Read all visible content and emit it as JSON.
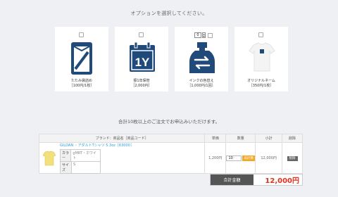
{
  "heading": "オプションを選択してください。",
  "options": [
    {
      "name": "たたみ袋詰め",
      "price": "［100円/1枚］",
      "icon": "folded-bag-icon"
    },
    {
      "name": "振1年保管",
      "price": "［2,000円］",
      "icon": "calendar-1y-icon"
    },
    {
      "name": "インクの色替え",
      "price": "［1,000円/1回］",
      "icon": "ink-bottle-swap-icon"
    },
    {
      "name": "オリジナルネーム",
      "price": "［350円/1枚］",
      "icon": "tshirt-label-icon"
    }
  ],
  "ink_qty": "0",
  "notice": "合計10枚以上のご注文でお申込みいただけます。",
  "table": {
    "headers": [
      "ブランド：商品名［商品コード］",
      "単価",
      "数量",
      "小計",
      "削除"
    ],
    "row": {
      "title": "GILDAN ・アダルトTシャツ 5.3oz［63000］",
      "color_label": "カラー",
      "color_value": "gMRT・ホワイト",
      "size_label": "サイズ",
      "size_value": "S",
      "unit_price": "1,200円",
      "qty": "10",
      "change_label": "再計算",
      "subtotal": "12,000円",
      "delete_label": "削除"
    }
  },
  "total": {
    "label": "合計金額",
    "amount": "12,000円"
  },
  "colors": {
    "navy": "#1f4a7a",
    "accent": "#f5a623",
    "price_red": "#e0301e",
    "link": "#29a0d8"
  }
}
